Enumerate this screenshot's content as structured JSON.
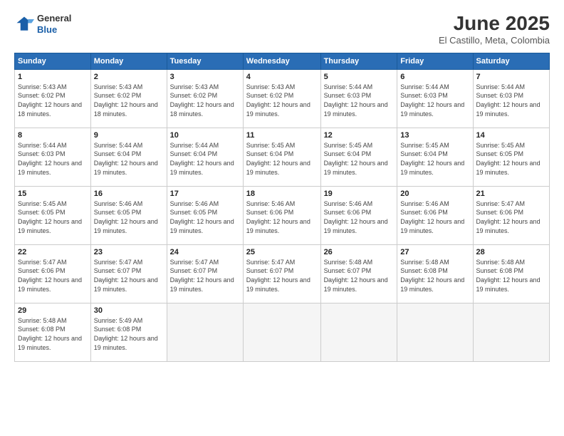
{
  "logo": {
    "general": "General",
    "blue": "Blue"
  },
  "title": "June 2025",
  "subtitle": "El Castillo, Meta, Colombia",
  "days_of_week": [
    "Sunday",
    "Monday",
    "Tuesday",
    "Wednesday",
    "Thursday",
    "Friday",
    "Saturday"
  ],
  "weeks": [
    [
      {
        "num": "1",
        "rise": "5:43 AM",
        "set": "6:02 PM",
        "daylight": "12 hours and 18 minutes."
      },
      {
        "num": "2",
        "rise": "5:43 AM",
        "set": "6:02 PM",
        "daylight": "12 hours and 18 minutes."
      },
      {
        "num": "3",
        "rise": "5:43 AM",
        "set": "6:02 PM",
        "daylight": "12 hours and 18 minutes."
      },
      {
        "num": "4",
        "rise": "5:43 AM",
        "set": "6:02 PM",
        "daylight": "12 hours and 19 minutes."
      },
      {
        "num": "5",
        "rise": "5:44 AM",
        "set": "6:03 PM",
        "daylight": "12 hours and 19 minutes."
      },
      {
        "num": "6",
        "rise": "5:44 AM",
        "set": "6:03 PM",
        "daylight": "12 hours and 19 minutes."
      },
      {
        "num": "7",
        "rise": "5:44 AM",
        "set": "6:03 PM",
        "daylight": "12 hours and 19 minutes."
      }
    ],
    [
      {
        "num": "8",
        "rise": "5:44 AM",
        "set": "6:03 PM",
        "daylight": "12 hours and 19 minutes."
      },
      {
        "num": "9",
        "rise": "5:44 AM",
        "set": "6:04 PM",
        "daylight": "12 hours and 19 minutes."
      },
      {
        "num": "10",
        "rise": "5:44 AM",
        "set": "6:04 PM",
        "daylight": "12 hours and 19 minutes."
      },
      {
        "num": "11",
        "rise": "5:45 AM",
        "set": "6:04 PM",
        "daylight": "12 hours and 19 minutes."
      },
      {
        "num": "12",
        "rise": "5:45 AM",
        "set": "6:04 PM",
        "daylight": "12 hours and 19 minutes."
      },
      {
        "num": "13",
        "rise": "5:45 AM",
        "set": "6:04 PM",
        "daylight": "12 hours and 19 minutes."
      },
      {
        "num": "14",
        "rise": "5:45 AM",
        "set": "6:05 PM",
        "daylight": "12 hours and 19 minutes."
      }
    ],
    [
      {
        "num": "15",
        "rise": "5:45 AM",
        "set": "6:05 PM",
        "daylight": "12 hours and 19 minutes."
      },
      {
        "num": "16",
        "rise": "5:46 AM",
        "set": "6:05 PM",
        "daylight": "12 hours and 19 minutes."
      },
      {
        "num": "17",
        "rise": "5:46 AM",
        "set": "6:05 PM",
        "daylight": "12 hours and 19 minutes."
      },
      {
        "num": "18",
        "rise": "5:46 AM",
        "set": "6:06 PM",
        "daylight": "12 hours and 19 minutes."
      },
      {
        "num": "19",
        "rise": "5:46 AM",
        "set": "6:06 PM",
        "daylight": "12 hours and 19 minutes."
      },
      {
        "num": "20",
        "rise": "5:46 AM",
        "set": "6:06 PM",
        "daylight": "12 hours and 19 minutes."
      },
      {
        "num": "21",
        "rise": "5:47 AM",
        "set": "6:06 PM",
        "daylight": "12 hours and 19 minutes."
      }
    ],
    [
      {
        "num": "22",
        "rise": "5:47 AM",
        "set": "6:06 PM",
        "daylight": "12 hours and 19 minutes."
      },
      {
        "num": "23",
        "rise": "5:47 AM",
        "set": "6:07 PM",
        "daylight": "12 hours and 19 minutes."
      },
      {
        "num": "24",
        "rise": "5:47 AM",
        "set": "6:07 PM",
        "daylight": "12 hours and 19 minutes."
      },
      {
        "num": "25",
        "rise": "5:47 AM",
        "set": "6:07 PM",
        "daylight": "12 hours and 19 minutes."
      },
      {
        "num": "26",
        "rise": "5:48 AM",
        "set": "6:07 PM",
        "daylight": "12 hours and 19 minutes."
      },
      {
        "num": "27",
        "rise": "5:48 AM",
        "set": "6:08 PM",
        "daylight": "12 hours and 19 minutes."
      },
      {
        "num": "28",
        "rise": "5:48 AM",
        "set": "6:08 PM",
        "daylight": "12 hours and 19 minutes."
      }
    ],
    [
      {
        "num": "29",
        "rise": "5:48 AM",
        "set": "6:08 PM",
        "daylight": "12 hours and 19 minutes."
      },
      {
        "num": "30",
        "rise": "5:49 AM",
        "set": "6:08 PM",
        "daylight": "12 hours and 19 minutes."
      },
      null,
      null,
      null,
      null,
      null
    ]
  ]
}
